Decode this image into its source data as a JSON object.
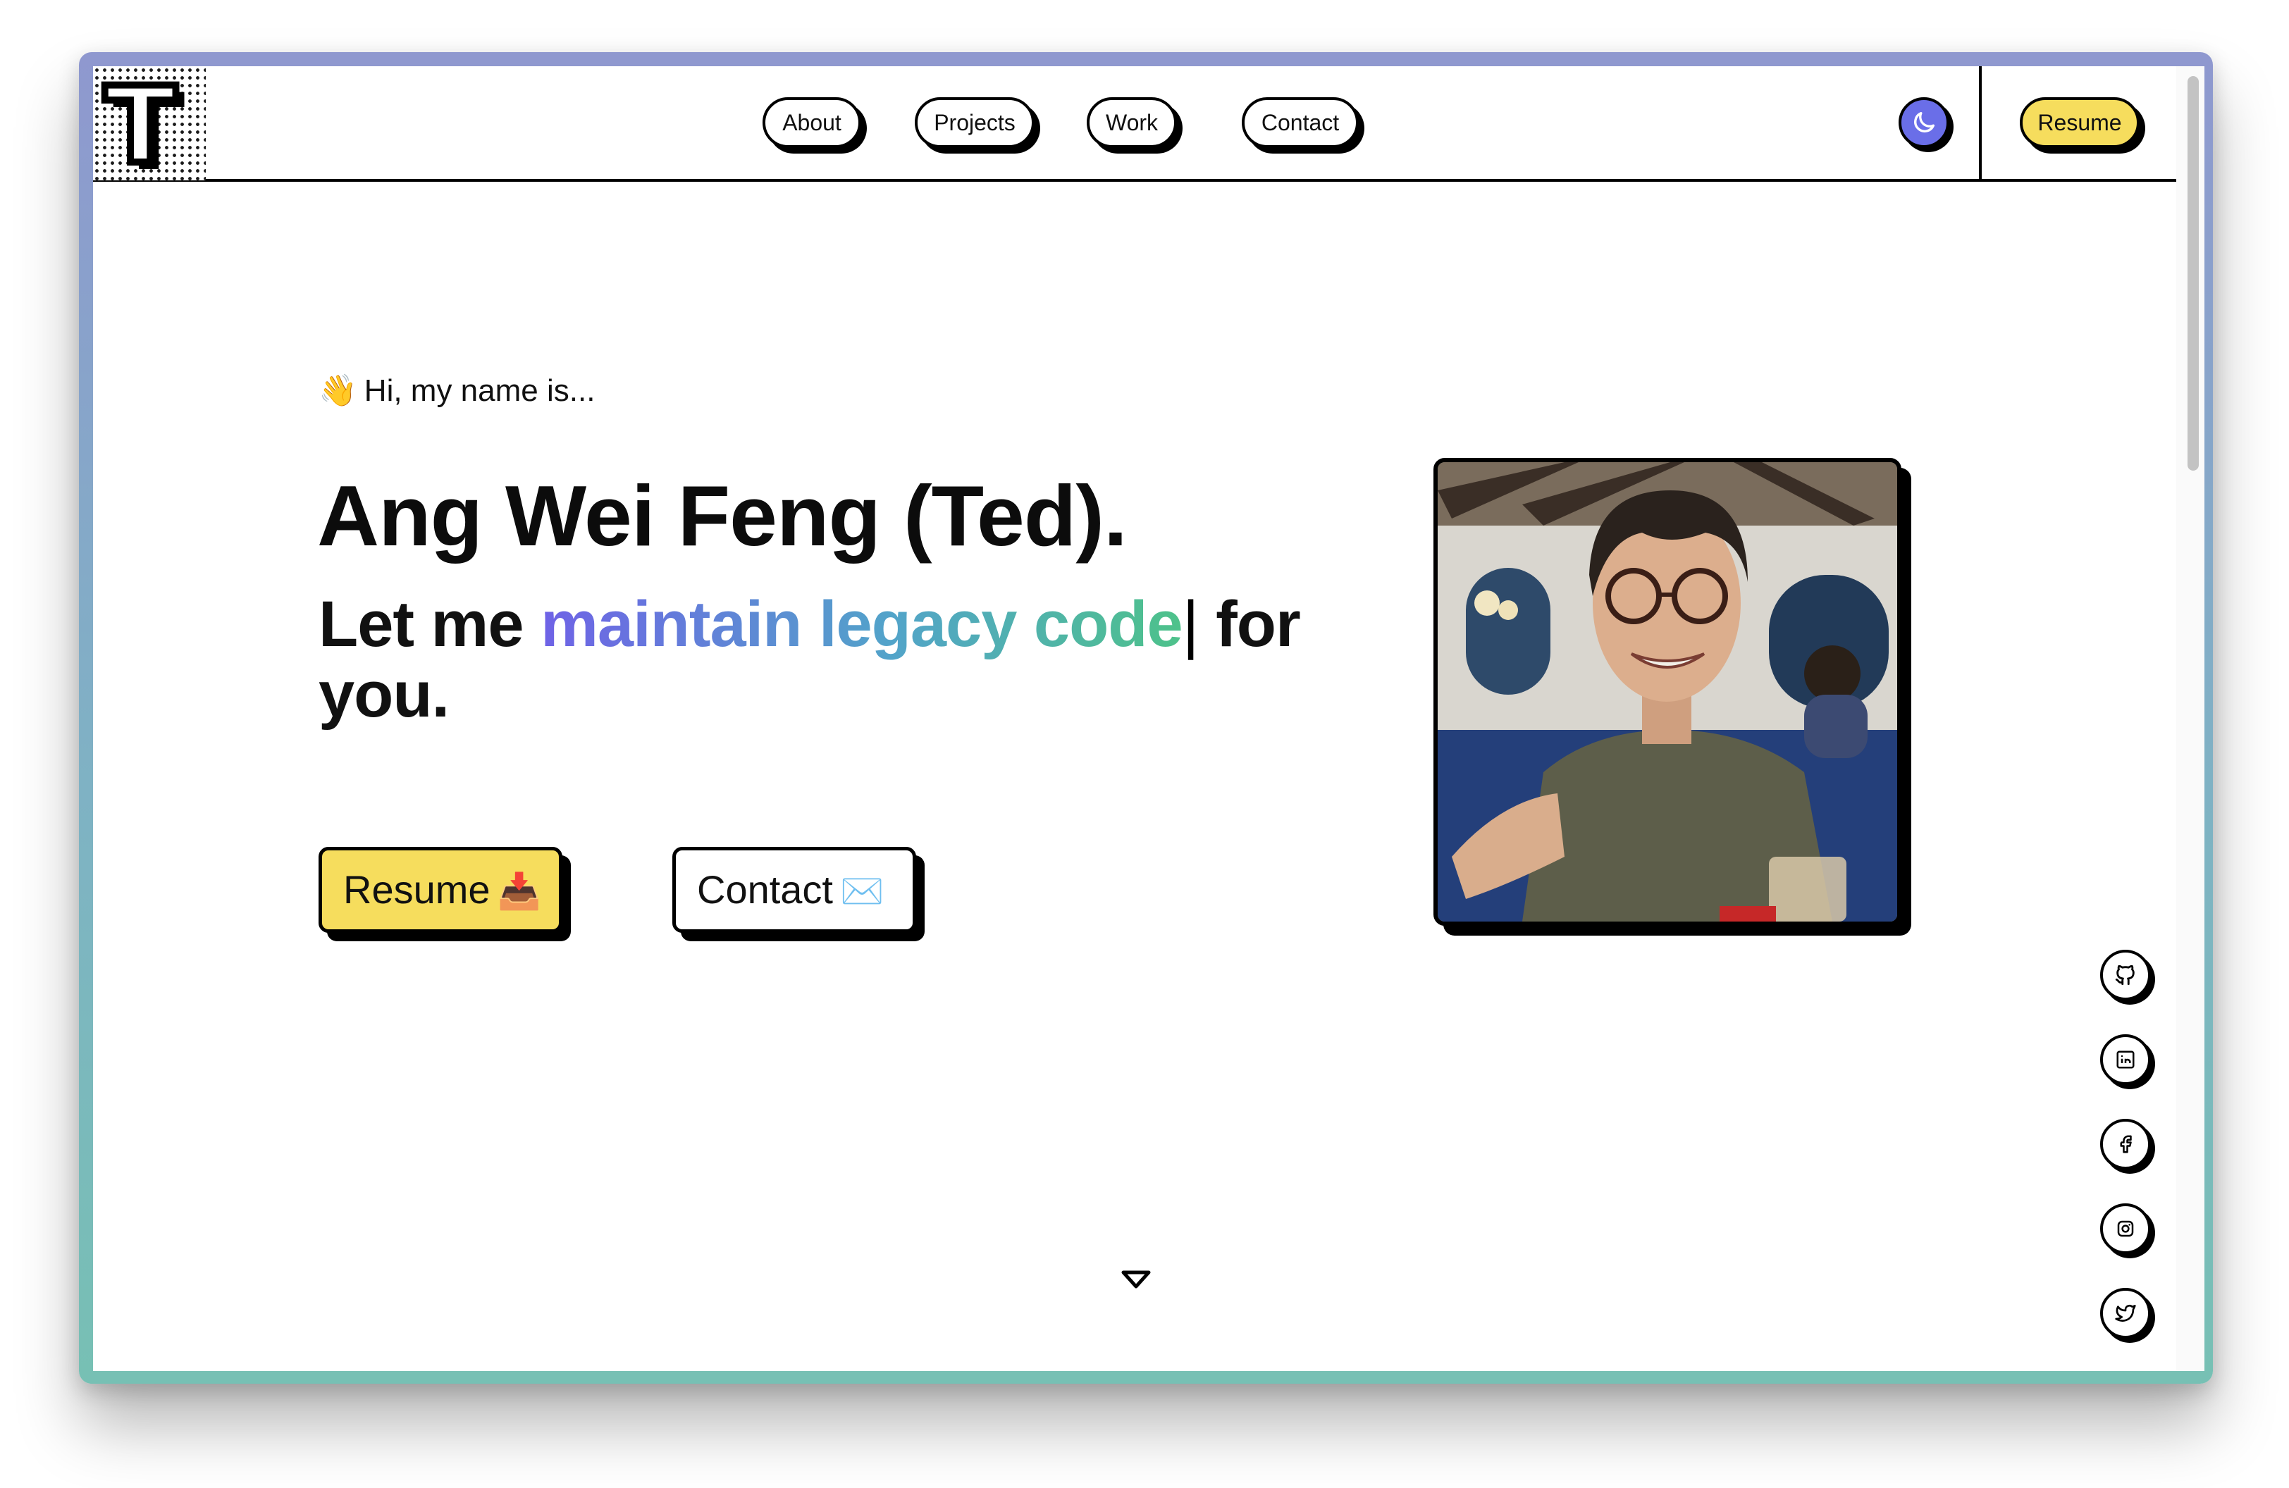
{
  "nav": {
    "links": [
      {
        "label": "About"
      },
      {
        "label": "Projects"
      },
      {
        "label": "Work"
      },
      {
        "label": "Contact"
      }
    ],
    "resume_label": "Resume",
    "logo_letter": "T"
  },
  "hero": {
    "greeting_emoji": "👋",
    "greeting": "Hi, my name is...",
    "name": "Ang Wei Feng (Ted).",
    "tagline_prefix": "Let me ",
    "tagline_highlight": "maintain legacy code",
    "tagline_cursor": "|",
    "tagline_suffix": " for you.",
    "resume_button": "Resume",
    "resume_emoji": "📥",
    "contact_button": "Contact",
    "contact_emoji": "✉️"
  },
  "socials": [
    "github-icon",
    "linkedin-icon",
    "facebook-icon",
    "instagram-icon",
    "twitter-icon"
  ],
  "colors": {
    "accent_yellow": "#f6dd5d",
    "theme_button": "#6a6ee8",
    "gradient_start": "#6f62e6",
    "gradient_mid": "#52a4c9",
    "gradient_end": "#4ec28a"
  }
}
